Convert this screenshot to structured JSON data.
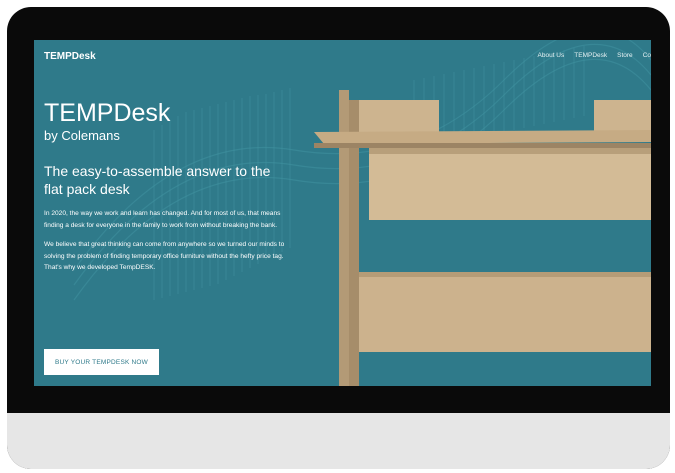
{
  "site": {
    "brand": "TEMPDesk",
    "nav": [
      "About Us",
      "TEMPDesk",
      "Store",
      "Co"
    ]
  },
  "hero": {
    "title": "TEMPDesk",
    "subtitle": "by Colemans",
    "tagline_line1": "The easy-to-assemble answer to the",
    "tagline_line2": "flat pack desk",
    "paragraph1": "In 2020, the way we work and learn has changed. And for most of us, that means finding a desk for everyone in the family to work from without breaking the bank.",
    "paragraph2": "We believe that great thinking can come from anywhere so we turned our minds to solving the problem of finding temporary office furniture without the hefty price tag. That's why we developed TempDESK.",
    "cta_label": "BUY YOUR TEMPDESK NOW"
  },
  "colors": {
    "screen_bg": "#2f7a8a",
    "monitor_frame": "#0a0a0a",
    "chin": "#e6e6e6",
    "cardboard": "#c9ad86"
  }
}
